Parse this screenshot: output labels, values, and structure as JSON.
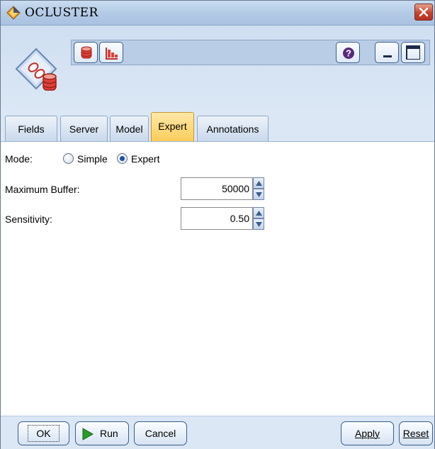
{
  "window": {
    "title": "OCLUSTER"
  },
  "icons": {
    "app": "node-diamond-icon",
    "node": "ocluster-node-icon",
    "close": "close-icon"
  },
  "toolbar": {
    "buttons": [
      {
        "icon": "database-icon"
      },
      {
        "icon": "bar-chart-icon"
      },
      {
        "icon": "help-icon"
      },
      {
        "icon": "minimize-icon"
      },
      {
        "icon": "maximize-icon"
      }
    ]
  },
  "tabs": [
    {
      "label": "Fields",
      "active": false
    },
    {
      "label": "Server",
      "active": false
    },
    {
      "label": "Model",
      "active": false
    },
    {
      "label": "Expert",
      "active": true
    },
    {
      "label": "Annotations",
      "active": false
    }
  ],
  "form": {
    "mode": {
      "label": "Mode:",
      "options": [
        "Simple",
        "Expert"
      ],
      "selected": "Expert"
    },
    "max_buffer": {
      "label": "Maximum Buffer:",
      "value": "50000"
    },
    "sensitivity": {
      "label": "Sensitivity:",
      "value": "0.50"
    }
  },
  "footer": {
    "ok": "OK",
    "run": "Run",
    "cancel": "Cancel",
    "apply": "Apply",
    "reset": "Reset"
  },
  "colors": {
    "active_tab": "#fccc5a",
    "header_bg": "#dbe7f5",
    "run_green": "#2a9a2a"
  }
}
